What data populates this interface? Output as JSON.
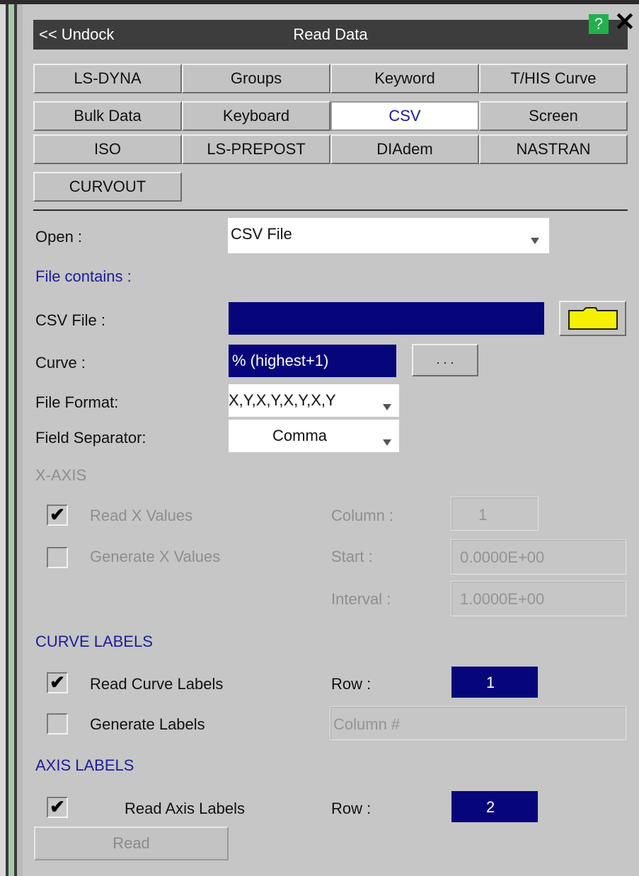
{
  "titlebar": {
    "undock_label": "<< Undock",
    "title": "Read Data",
    "help_glyph": "?",
    "close_glyph": "✕"
  },
  "tabs": [
    {
      "label": "LS-DYNA"
    },
    {
      "label": "Groups"
    },
    {
      "label": "Keyword"
    },
    {
      "label": "T/HIS Curve"
    },
    {
      "label": "Bulk Data"
    },
    {
      "label": "Keyboard"
    },
    {
      "label": "CSV",
      "active": true
    },
    {
      "label": "Screen"
    },
    {
      "label": "ISO"
    },
    {
      "label": "LS-PREPOST"
    },
    {
      "label": "DIAdem"
    },
    {
      "label": "NASTRAN"
    },
    {
      "label": "CURVOUT"
    }
  ],
  "open": {
    "label": "Open :",
    "value": "CSV File"
  },
  "file_contains": "File contains :",
  "csv_file": {
    "label": "CSV File :",
    "value": "",
    "browse_icon": "folder-icon"
  },
  "curve": {
    "label": "Curve :",
    "value": "% (highest+1)",
    "button": ". . ."
  },
  "file_format": {
    "label": "File Format:",
    "value": "X,Y,X,Y,X,Y,X,Y"
  },
  "field_separator": {
    "label": "Field Separator:",
    "value": "Comma"
  },
  "x_axis": {
    "heading": "X-AXIS",
    "read_x": {
      "label": "Read X Values",
      "checked": true
    },
    "generate_x": {
      "label": "Generate X Values",
      "checked": false
    },
    "column": {
      "label": "Column :",
      "value": "1"
    },
    "start": {
      "label": "Start :",
      "value": "0.0000E+00"
    },
    "interval": {
      "label": "Interval :",
      "value": "1.0000E+00"
    }
  },
  "curve_labels": {
    "heading": "CURVE LABELS",
    "read": {
      "label": "Read Curve Labels",
      "checked": true
    },
    "generate": {
      "label": "Generate Labels",
      "checked": false
    },
    "row": {
      "label": "Row :",
      "value": "1"
    },
    "column_placeholder": "Column #"
  },
  "axis_labels": {
    "heading": "AXIS LABELS",
    "read": {
      "label": "Read Axis Labels",
      "checked": true
    },
    "row": {
      "label": "Row :",
      "value": "2"
    }
  },
  "read_button": "Read",
  "check_glyph": "✔",
  "colors": {
    "titlebar": "#3d3d3d",
    "selected_field": "#06067a",
    "heading_blue": "#1c1c9a",
    "folder": "#f5f000",
    "help": "#22b14c"
  }
}
